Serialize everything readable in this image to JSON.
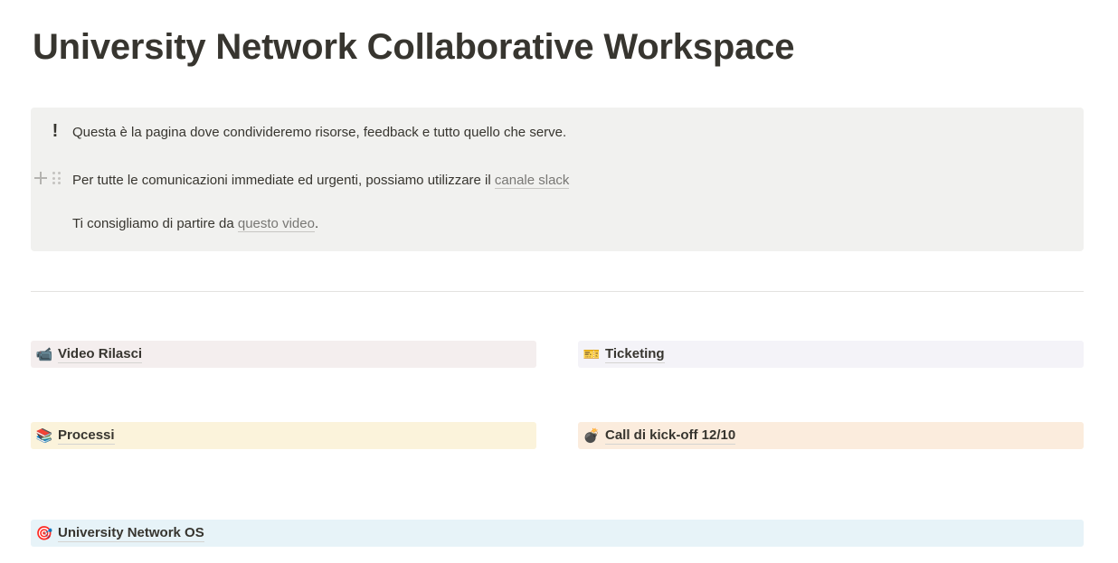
{
  "page": {
    "title": "University Network Collaborative Workspace"
  },
  "callout": {
    "icon": "exclamation-icon",
    "line1": "Questa è la pagina dove condivideremo risorse, feedback e tutto quello che serve.",
    "line2_text": "Per tutte le comunicazioni immediate ed urgenti, possiamo utilizzare il ",
    "line2_link": "canale slack",
    "line3_text": "Ti consigliamo di partire da ",
    "line3_link": "questo video",
    "line3_suffix": "."
  },
  "links": {
    "video": {
      "label": "Video Rilasci",
      "icon": "📹",
      "color": "#f4eeee"
    },
    "ticketing": {
      "label": "Ticketing",
      "icon": "🎫",
      "color": "#f4f3f8"
    },
    "processi": {
      "label": "Processi",
      "icon": "📚",
      "color": "#fbf3db"
    },
    "call": {
      "label": "Call di kick-off 12/10",
      "icon": "💣",
      "color": "#fbecdd"
    },
    "os": {
      "label": "University Network OS",
      "icon": "🎯",
      "color": "#e7f3f8"
    }
  },
  "colors": {
    "text": "#37352f",
    "callout_bg": "#f1f1ef",
    "link_muted": "#787774",
    "divider": "#e3e2e0"
  }
}
